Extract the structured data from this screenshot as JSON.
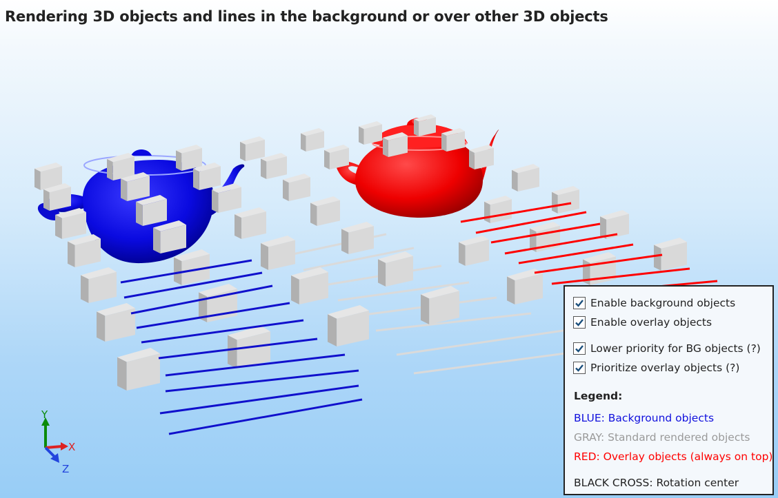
{
  "page": {
    "title": "Rendering 3D objects and lines in the background or over other 3D objects"
  },
  "scene": {
    "background_objects_color": "#1010dd",
    "standard_objects_color": "#c8c8c8",
    "overlay_objects_color": "#ff0000",
    "axes": {
      "x": "X",
      "y": "Y",
      "z": "Z"
    }
  },
  "panel": {
    "checkboxes": [
      {
        "label": "Enable background objects",
        "checked": true
      },
      {
        "label": "Enable overlay objects",
        "checked": true
      },
      {
        "label": "Lower priority for BG objects (?)",
        "checked": true
      },
      {
        "label": "Prioritize overlay objects (?)",
        "checked": true
      }
    ],
    "legend": {
      "title": "Legend:",
      "items": [
        {
          "text": "BLUE: Background objects",
          "color": "#1010dd"
        },
        {
          "text": "GRAY: Standard rendered objects",
          "color": "#9a9a9a"
        },
        {
          "text": "RED: Overlay objects (always on top)",
          "color": "#ff0000"
        },
        {
          "text": "BLACK CROSS: Rotation center",
          "color": "#222222"
        }
      ]
    }
  }
}
